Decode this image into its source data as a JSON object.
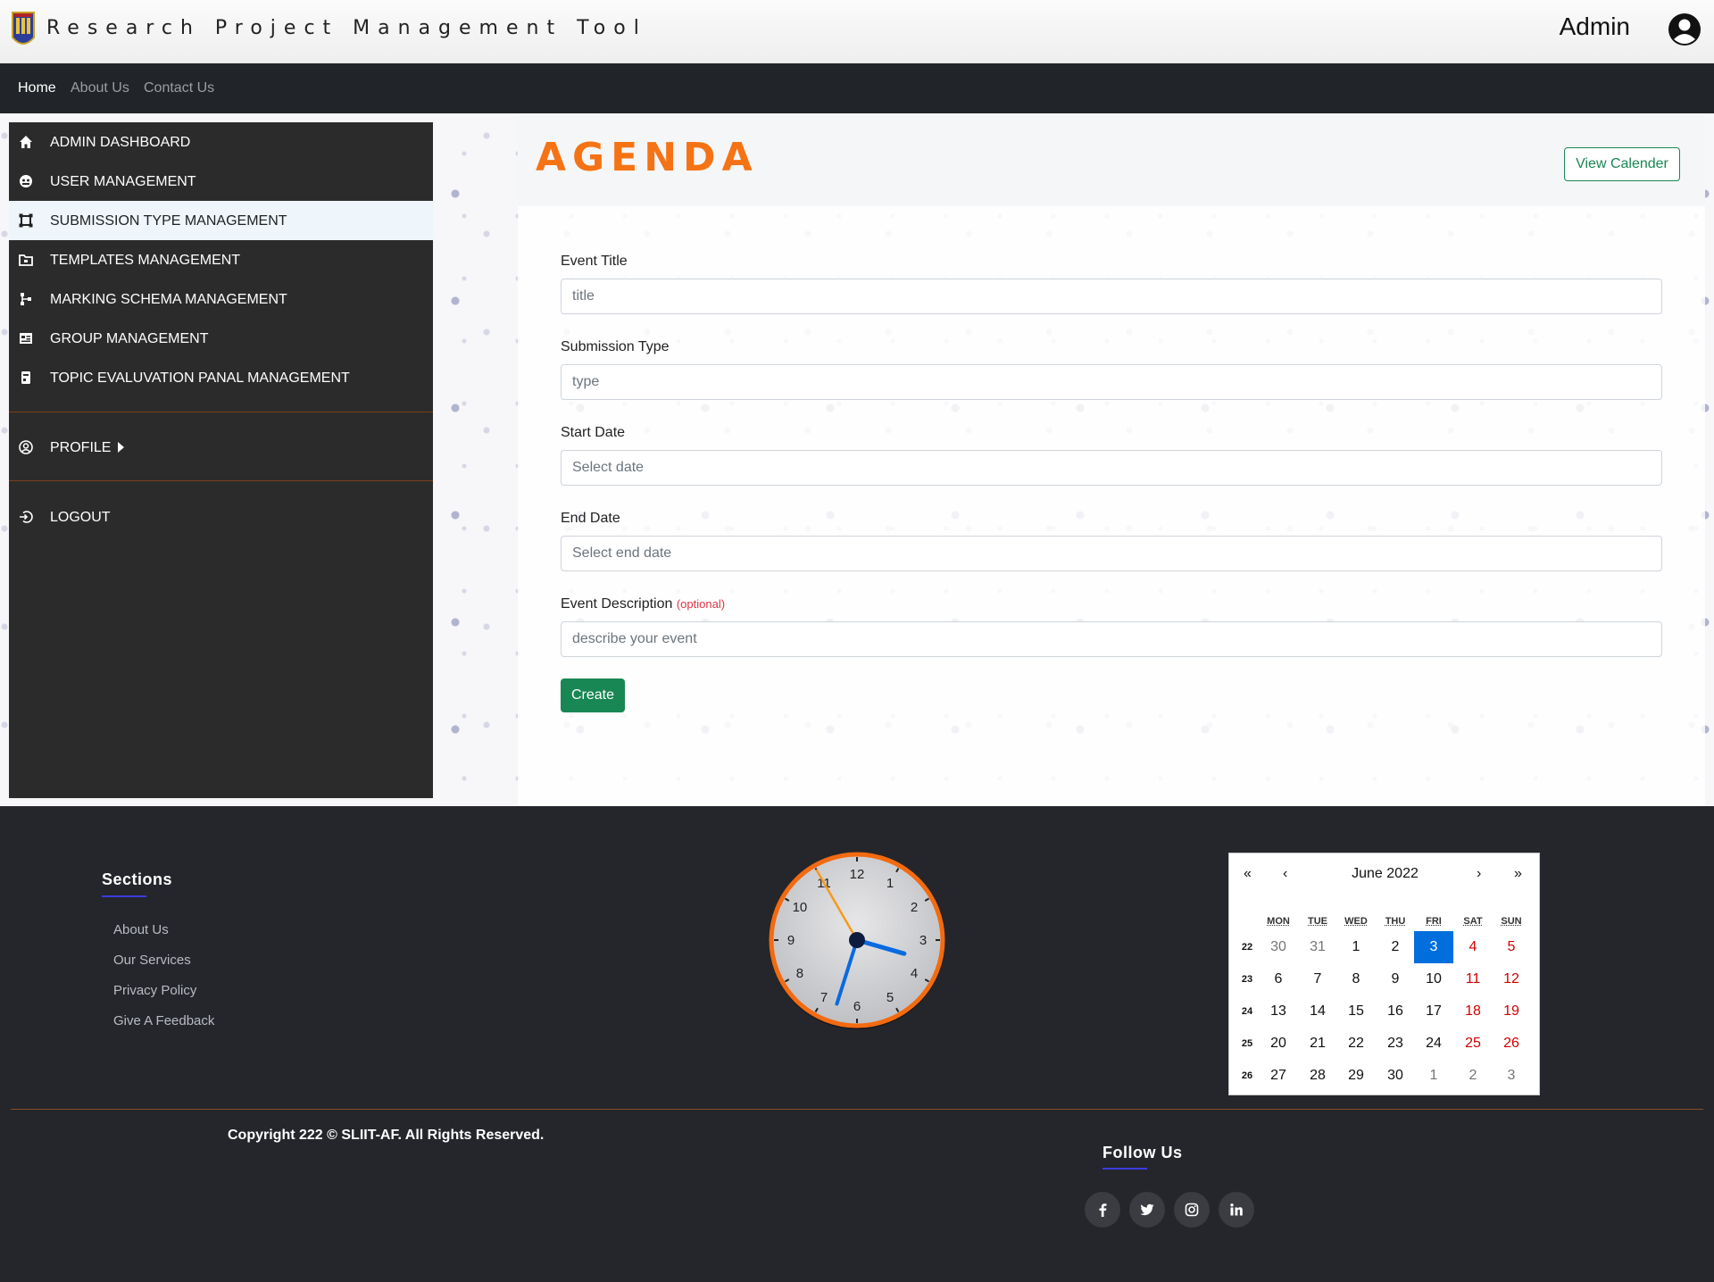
{
  "header": {
    "app_title": "Research Project Management Tool",
    "user_name": "Admin"
  },
  "nav": {
    "items": [
      "Home",
      "About Us",
      "Contact Us"
    ],
    "active": "Home"
  },
  "sidebar": {
    "items": [
      {
        "label": "ADMIN DASHBOARD",
        "icon": "home-icon"
      },
      {
        "label": "USER MANAGEMENT",
        "icon": "users-icon"
      },
      {
        "label": "SUBMISSION TYPE MANAGEMENT",
        "icon": "submission-icon"
      },
      {
        "label": "TEMPLATES MANAGEMENT",
        "icon": "folder-icon"
      },
      {
        "label": "MARKING SCHEMA MANAGEMENT",
        "icon": "hierarchy-icon"
      },
      {
        "label": "GROUP MANAGEMENT",
        "icon": "group-card-icon"
      },
      {
        "label": "TOPIC EVALUVATION PANAL MANAGEMENT",
        "icon": "clipboard-icon"
      }
    ],
    "active_index": 2,
    "profile_label": "PROFILE",
    "logout_label": "LOGOUT"
  },
  "main": {
    "title": "AGENDA",
    "view_calendar_label": "View Calender",
    "form": {
      "fields": [
        {
          "label": "Event Title",
          "placeholder": "title"
        },
        {
          "label": "Submission Type",
          "placeholder": "type"
        },
        {
          "label": "Start Date",
          "placeholder": "Select date"
        },
        {
          "label": "End Date",
          "placeholder": "Select end date"
        },
        {
          "label": "Event Description",
          "optional_note": "(optional)",
          "placeholder": "describe your event"
        }
      ],
      "submit_label": "Create"
    }
  },
  "footer": {
    "sections_title": "Sections",
    "links": [
      "About Us",
      "Our Services",
      "Privacy Policy",
      "Give A Feedback"
    ],
    "clock": {
      "hours": 3,
      "minutes": 32,
      "seconds": 55
    },
    "calendar": {
      "month_label": "June 2022",
      "nav": [
        "«",
        "‹",
        "›",
        "»"
      ],
      "weekdays": [
        "MON",
        "TUE",
        "WED",
        "THU",
        "FRI",
        "SAT",
        "SUN"
      ],
      "weeks": [
        {
          "week": "22",
          "days": [
            "30",
            "31",
            "1",
            "2",
            "3",
            "4",
            "5"
          ]
        },
        {
          "week": "23",
          "days": [
            "6",
            "7",
            "8",
            "9",
            "10",
            "11",
            "12"
          ]
        },
        {
          "week": "24",
          "days": [
            "13",
            "14",
            "15",
            "16",
            "17",
            "18",
            "19"
          ]
        },
        {
          "week": "25",
          "days": [
            "20",
            "21",
            "22",
            "23",
            "24",
            "25",
            "26"
          ]
        },
        {
          "week": "26",
          "days": [
            "27",
            "28",
            "29",
            "30",
            "1",
            "2",
            "3"
          ]
        }
      ],
      "selected_day": "3"
    },
    "copyright": "Copyright 222 © SLIIT-AF. All Rights Reserved.",
    "follow_title": "Follow Us",
    "social": [
      "facebook-icon",
      "twitter-icon",
      "instagram-icon",
      "linkedin-icon"
    ]
  },
  "colors": {
    "accent": "#f57314",
    "success": "#198754",
    "nav_bg": "#212529",
    "sidebar_bg": "#2b2b2b",
    "footer_bg": "#24262b",
    "calendar_selected": "#006edc"
  }
}
